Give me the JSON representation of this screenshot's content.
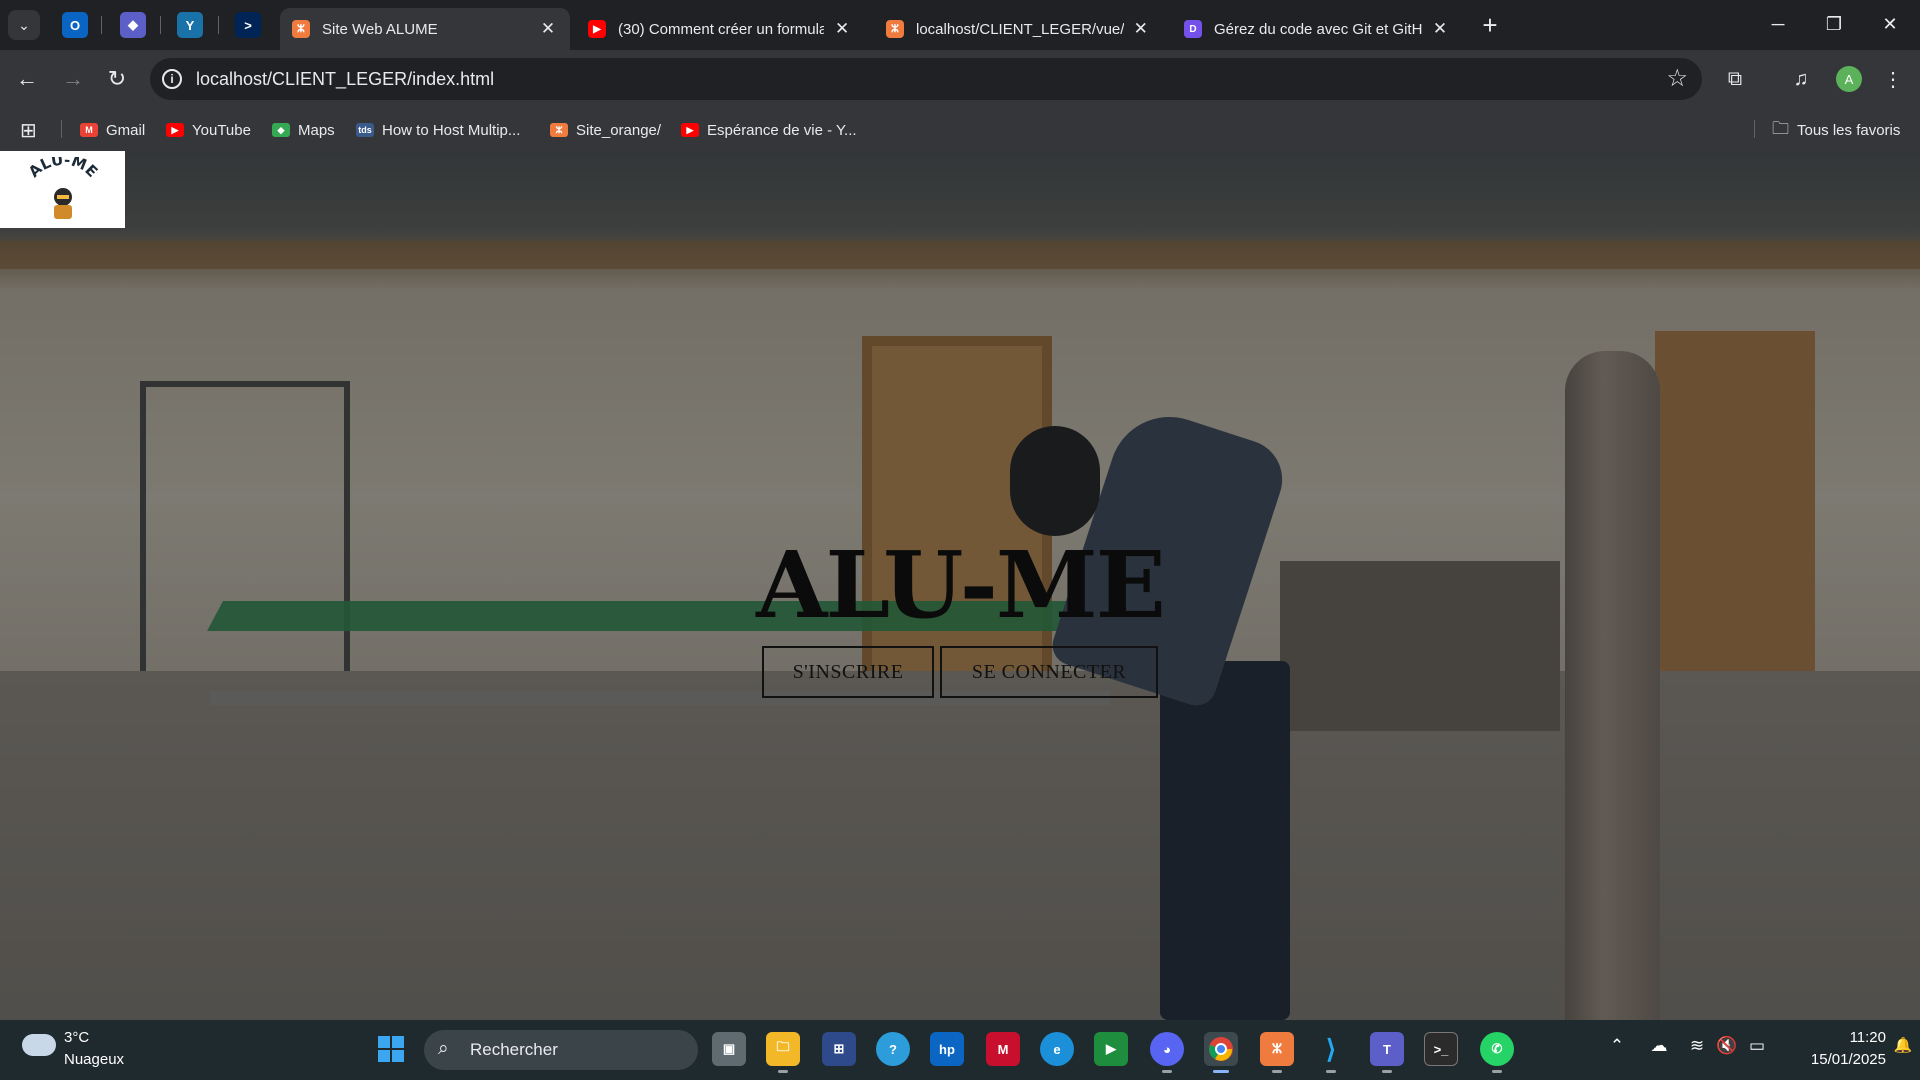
{
  "browser": {
    "tabs": [
      {
        "title": "Site Web ALUME",
        "active": true,
        "favicon": "xampp-icon"
      },
      {
        "title": "(30) Comment créer un formula",
        "active": false,
        "favicon": "youtube-icon"
      },
      {
        "title": "localhost/CLIENT_LEGER/vue/vu",
        "active": false,
        "favicon": "xampp-icon"
      },
      {
        "title": "Gérez du code avec Git et GitH",
        "active": false,
        "favicon": "openclassrooms-icon"
      }
    ],
    "pinned_tabs": [
      "outlook-icon",
      "copilot-icon",
      "yammer-icon",
      "powershell-icon"
    ],
    "url": "localhost/CLIENT_LEGER/index.html",
    "profile_initial": "A",
    "bookmarks": [
      {
        "label": "Gmail",
        "icon": "gmail-icon"
      },
      {
        "label": "YouTube",
        "icon": "youtube-icon"
      },
      {
        "label": "Maps",
        "icon": "maps-icon"
      },
      {
        "label": "How to Host Multip...",
        "icon": "tds-icon"
      },
      {
        "label": "Site_orange/",
        "icon": "xampp-icon"
      },
      {
        "label": "Espérance de vie - Y...",
        "icon": "youtube-icon"
      }
    ],
    "all_bookmarks_label": "Tous les favoris"
  },
  "page": {
    "logo_text": "ALU-ME",
    "hero_title": "ALU-ME",
    "signup_label": "S'INSCRIRE",
    "login_label": "SE CONNECTER"
  },
  "taskbar": {
    "weather_temp": "3°C",
    "weather_desc": "Nuageux",
    "search_placeholder": "Rechercher",
    "time": "11:20",
    "date": "15/01/2025"
  },
  "colors": {
    "tab_strip": "#202124",
    "toolbar": "#35363a",
    "taskbar": "#1f2a2e",
    "hero_text": "#0b0b0b"
  }
}
